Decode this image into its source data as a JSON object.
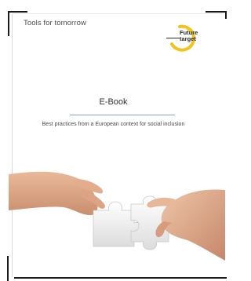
{
  "header": {
    "tagline": "Tools for tomorrow",
    "logo": {
      "line1": "Future",
      "line2": "target",
      "ring_color": "#f2c31b"
    }
  },
  "cover": {
    "title": "E-Book",
    "subtitle": "Best practices from a European context for social inclusion",
    "rule_color": "#7fa7c9"
  },
  "illustration": {
    "subject": "two hands joining white puzzle pieces",
    "icon": "puzzle-hands-illustration"
  }
}
